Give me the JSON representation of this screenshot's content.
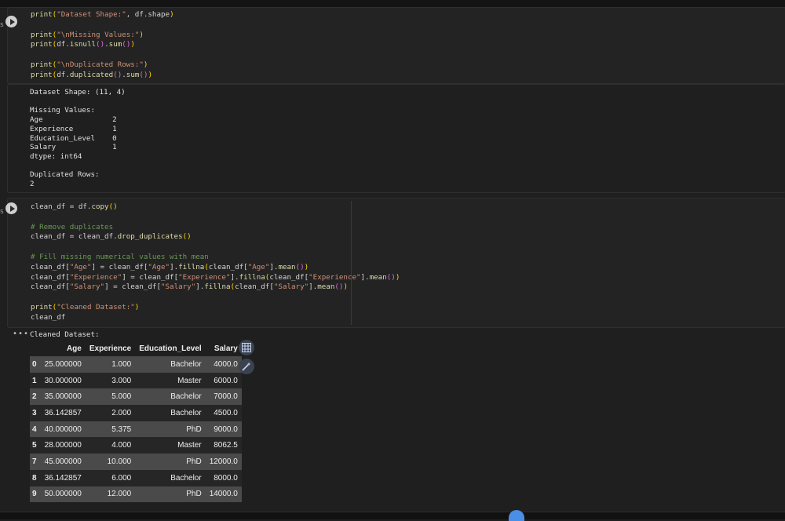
{
  "cell1": {
    "code_lines": [
      "print(\"Dataset Shape:\", df.shape)",
      "",
      "print(\"\\nMissing Values:\")",
      "print(df.isnull().sum())",
      "",
      "print(\"\\nDuplicated Rows:\")",
      "print(df.duplicated().sum())"
    ],
    "output_lines": [
      "Dataset Shape: (11, 4)",
      "",
      "Missing Values:",
      "Age                2",
      "Experience         1",
      "Education_Level    0",
      "Salary             1",
      "dtype: int64",
      "",
      "Duplicated Rows:",
      "2"
    ]
  },
  "cell2": {
    "code_lines": [
      "clean_df = df.copy()",
      "",
      "# Remove duplicates",
      "clean_df = clean_df.drop_duplicates()",
      "",
      "# Fill missing numerical values with mean",
      "clean_df[\"Age\"] = clean_df[\"Age\"].fillna(clean_df[\"Age\"].mean())",
      "clean_df[\"Experience\"] = clean_df[\"Experience\"].fillna(clean_df[\"Experience\"].mean())",
      "clean_df[\"Salary\"] = clean_df[\"Salary\"].fillna(clean_df[\"Salary\"].mean())",
      "",
      "print(\"Cleaned Dataset:\")",
      "clean_df"
    ],
    "output_header": "Cleaned Dataset:",
    "table": {
      "columns": [
        "",
        "Age",
        "Experience",
        "Education_Level",
        "Salary"
      ],
      "rows": [
        [
          "0",
          "25.000000",
          "1.000",
          "Bachelor",
          "4000.0"
        ],
        [
          "1",
          "30.000000",
          "3.000",
          "Master",
          "6000.0"
        ],
        [
          "2",
          "35.000000",
          "5.000",
          "Bachelor",
          "7000.0"
        ],
        [
          "3",
          "36.142857",
          "2.000",
          "Bachelor",
          "4500.0"
        ],
        [
          "4",
          "40.000000",
          "5.375",
          "PhD",
          "9000.0"
        ],
        [
          "5",
          "28.000000",
          "4.000",
          "Master",
          "8062.5"
        ],
        [
          "7",
          "45.000000",
          "10.000",
          "PhD",
          "12000.0"
        ],
        [
          "8",
          "36.142857",
          "6.000",
          "Bachelor",
          "8000.0"
        ],
        [
          "9",
          "50.000000",
          "12.000",
          "PhD",
          "14000.0"
        ]
      ]
    },
    "icons": {
      "table_button": "table-grid-icon",
      "suggest_button": "magic-wand-icon"
    }
  },
  "output_marker": "•••",
  "edge_marker": "s",
  "colors": {
    "background": "#1f1f1f",
    "cell": "#232323",
    "string": "#ce9178",
    "function": "#dcdcaa",
    "comment": "#6a9955",
    "accent": "#4a8fe7"
  }
}
